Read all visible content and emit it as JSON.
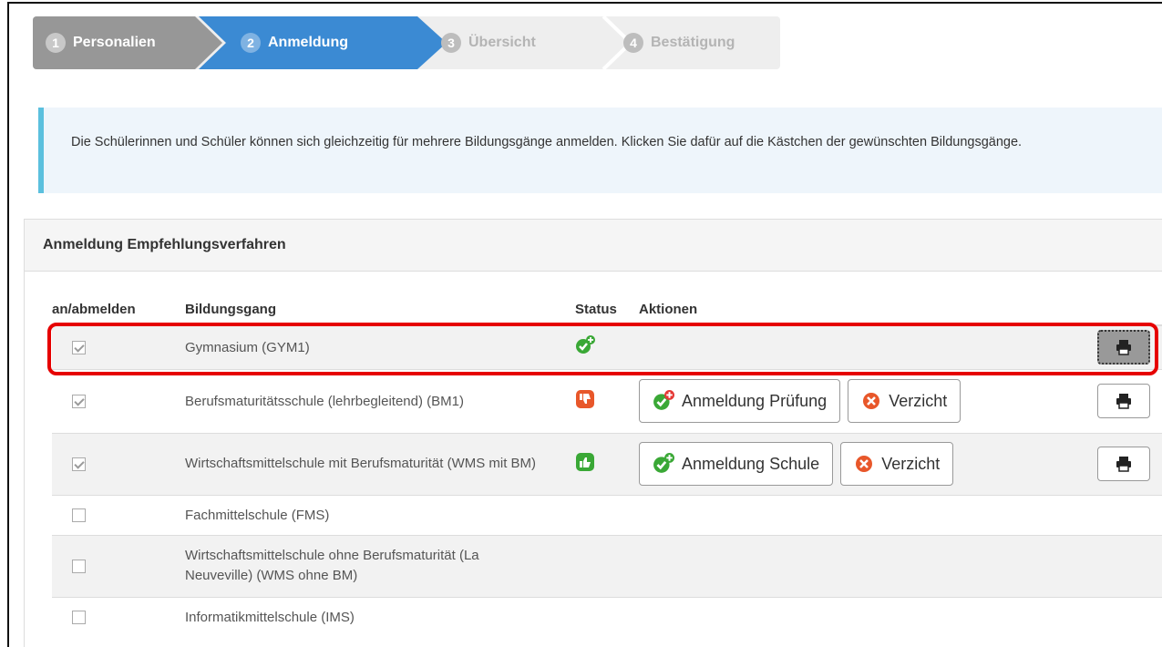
{
  "wizard": {
    "steps": [
      {
        "num": "1",
        "label": "Personalien"
      },
      {
        "num": "2",
        "label": "Anmeldung"
      },
      {
        "num": "3",
        "label": "Übersicht"
      },
      {
        "num": "4",
        "label": "Bestätigung"
      }
    ]
  },
  "info": {
    "text": "Die Schülerinnen und Schüler können sich gleichzeitig für mehrere Bildungsgänge anmelden. Klicken Sie dafür auf die Kästchen der gewünschten Bildungsgänge."
  },
  "panel": {
    "title": "Anmeldung Empfehlungsverfahren",
    "columns": [
      "an/abmelden",
      "Bildungsgang",
      "Status",
      "Aktionen"
    ],
    "rows": [
      {
        "name": "Gymnasium (GYM1)",
        "checked": true,
        "status_icon": "check-plus-icon",
        "actions": []
      },
      {
        "name": "Berufsmaturitätsschule (lehrbegleitend) (BM1)",
        "checked": true,
        "status_icon": "thumbs-down-icon",
        "actions": [
          "Anmeldung Prüfung",
          "Verzicht"
        ]
      },
      {
        "name": "Wirtschaftsmittelschule mit Berufsmaturität (WMS mit BM)",
        "checked": true,
        "status_icon": "thumbs-up-icon",
        "actions": [
          "Anmeldung Schule",
          "Verzicht"
        ]
      },
      {
        "name": "Fachmittelschule (FMS)",
        "checked": false
      },
      {
        "name": "Wirtschaftsmittelschule ohne Berufsmaturität (La Neuveville) (WMS ohne BM)",
        "checked": false
      },
      {
        "name": "Informatikmittelschule (IMS)",
        "checked": false
      }
    ]
  },
  "colors": {
    "active_step": "#3b8ad3",
    "done_step": "#979797",
    "highlight": "#e60000",
    "info_border": "#5bc0de"
  }
}
